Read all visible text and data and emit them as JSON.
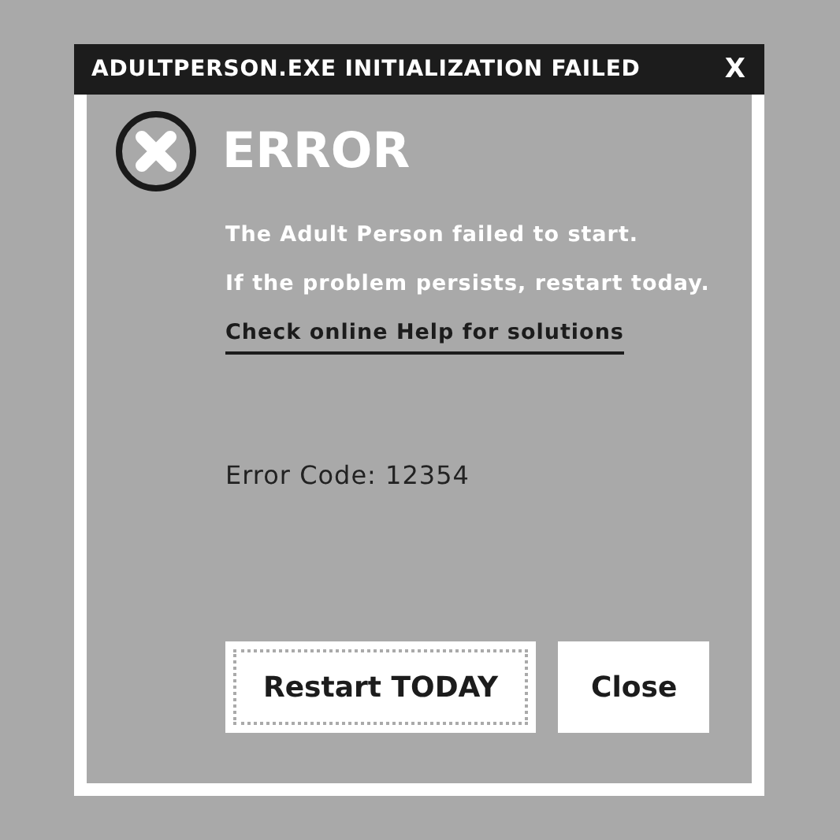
{
  "window": {
    "title": "ADULTPERSON.EXE INITIALIZATION FAILED",
    "close": "X"
  },
  "heading": "ERROR",
  "messages": [
    "The Adult Person failed to start.",
    "If the problem persists, restart today."
  ],
  "help_link": "Check online Help for solutions",
  "error_code": "Error Code: 12354",
  "buttons": [
    {
      "label": "Restart TODAY",
      "focused": true
    },
    {
      "label": "Close",
      "focused": false
    }
  ]
}
